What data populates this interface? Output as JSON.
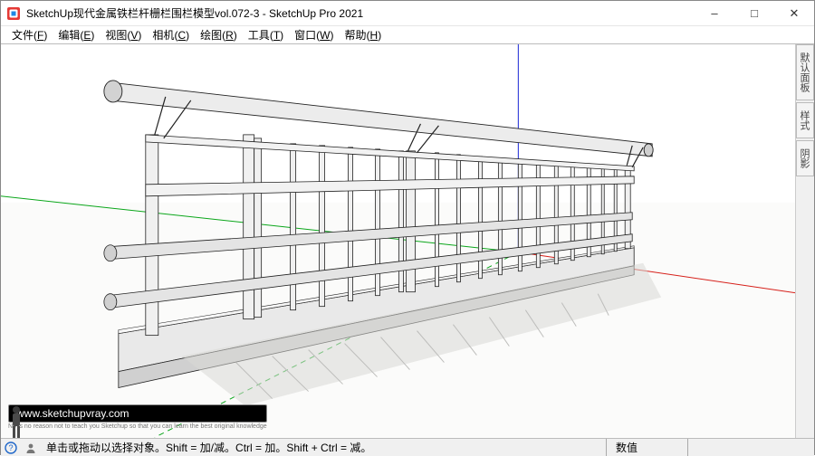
{
  "window": {
    "title": "SketchUp现代金属铁栏杆栅栏围栏模型vol.072-3 - SketchUp Pro 2021"
  },
  "menu": {
    "file": {
      "label": "文件",
      "key": "F"
    },
    "edit": {
      "label": "编辑",
      "key": "E"
    },
    "view": {
      "label": "视图",
      "key": "V"
    },
    "camera": {
      "label": "相机",
      "key": "C"
    },
    "draw": {
      "label": "绘图",
      "key": "R"
    },
    "tools": {
      "label": "工具",
      "key": "T"
    },
    "window": {
      "label": "窗口",
      "key": "W"
    },
    "help": {
      "label": "帮助",
      "key": "H"
    }
  },
  "tray": {
    "default": "默认面板",
    "styles": "样式",
    "shadows": "阴影"
  },
  "status": {
    "hint": "单击或拖动以选择对象。Shift = 加/减。Ctrl = 加。Shift + Ctrl = 减。",
    "value_label": "数值"
  },
  "watermark": {
    "url": "www.sketchupvray.com",
    "tagline": "No is no reason not to teach you Sketchup so that you can learn the best original knowledge"
  }
}
